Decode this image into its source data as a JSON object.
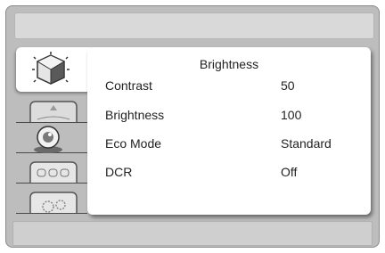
{
  "osd": {
    "panel_title": "Brightness",
    "rows": [
      {
        "label": "Contrast",
        "value": "50"
      },
      {
        "label": "Brightness",
        "value": "100"
      },
      {
        "label": "Eco Mode",
        "value": "Standard"
      },
      {
        "label": "DCR",
        "value": "Off"
      }
    ]
  },
  "menu_tabs": [
    {
      "icon": "brightness-cube-icon",
      "active": true
    },
    {
      "icon": "image-position-icon",
      "active": false
    },
    {
      "icon": "color-setting-icon",
      "active": false
    },
    {
      "icon": "osd-setting-icon",
      "active": false
    },
    {
      "icon": "extra-setting-icon",
      "active": false
    }
  ]
}
